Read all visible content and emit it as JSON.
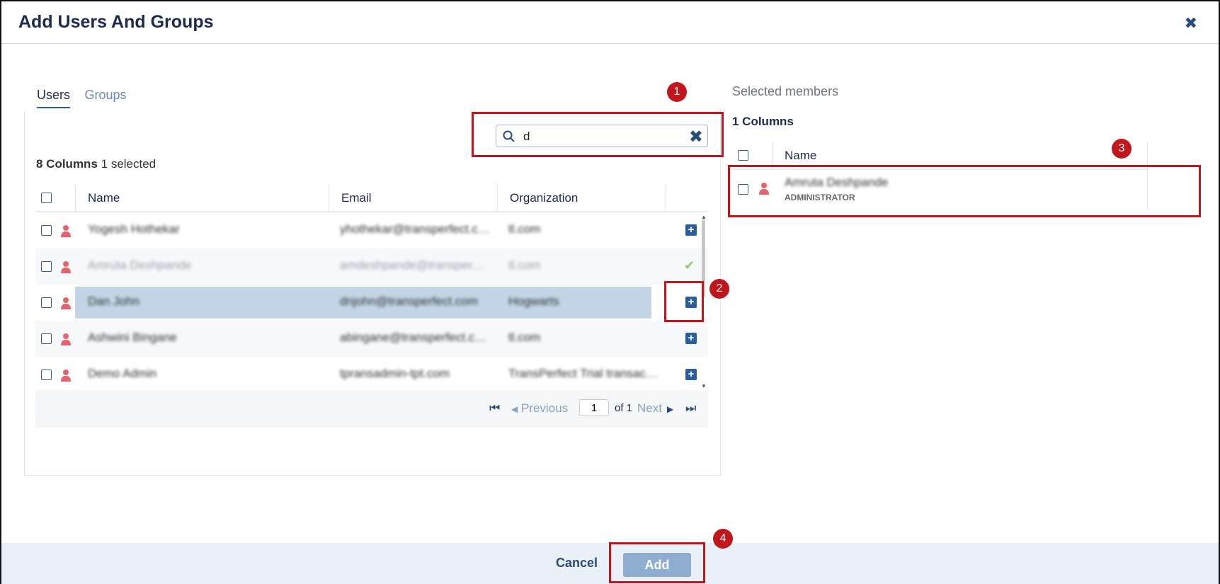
{
  "dialog": {
    "title": "Add Users And Groups"
  },
  "tabs": [
    {
      "label": "Users",
      "active": true
    },
    {
      "label": "Groups",
      "active": false
    }
  ],
  "search": {
    "value": "d"
  },
  "users_table": {
    "column_count_label": "8 Columns",
    "selected_label": "1 selected",
    "headers": [
      "Name",
      "Email",
      "Organization"
    ],
    "rows": [
      {
        "name": "Yogesh Hothekar",
        "email": "yhothekar@transperfect.c…",
        "org": "tl.com",
        "action": "add"
      },
      {
        "name": "Amruta Deshpande",
        "email": "amdeshpande@transper…",
        "org": "tl.com",
        "action": "added"
      },
      {
        "name": "Dan John",
        "email": "dnjohn@transperfect.com",
        "org": "Hogwarts",
        "action": "add"
      },
      {
        "name": "Ashwini Bingane",
        "email": "abingane@transperfect.c…",
        "org": "tl.com",
        "action": "add"
      },
      {
        "name": "Demo Admin",
        "email": "tpransadmin-tpt.com",
        "org": "TransPerfect Trial transac…",
        "action": "add"
      }
    ]
  },
  "pagination": {
    "previous": "Previous",
    "page": "1",
    "of": "of 1",
    "next": "Next"
  },
  "selected_members": {
    "title": "Selected members",
    "column_count_label": "1 Columns",
    "header": "Name",
    "rows": [
      {
        "name": "Amruta Deshpande",
        "role": "ADMINISTRATOR"
      }
    ]
  },
  "footer": {
    "cancel": "Cancel",
    "add": "Add"
  },
  "annotations": [
    "1",
    "2",
    "3",
    "4"
  ],
  "colors": {
    "accent": "#2a5d9c",
    "annotation_red": "#c0161c",
    "selected_row": "#c3d5e6",
    "person_icon": "#e8626b"
  }
}
